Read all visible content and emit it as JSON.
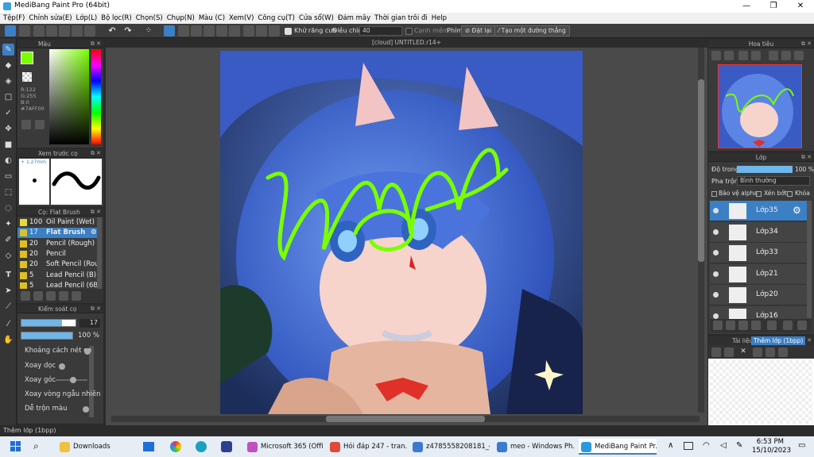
{
  "window": {
    "title": "MediBang Paint Pro (64bit)"
  },
  "menu": [
    "Tệp(F)",
    "Chỉnh sửa(E)",
    "Lớp(L)",
    "Bộ lọc(R)",
    "Chọn(S)",
    "Chụp(N)",
    "Màu (C)",
    "Xem(V)",
    "Công cụ(T)",
    "Cửa sổ(W)",
    "Đám mây",
    "Thời gian trôi đi",
    "Help"
  ],
  "toolbar": {
    "antialias_label": "Khử răng cưa",
    "correction_label": "Điều chỉnh",
    "correction_value": "40",
    "edge_label": "Cạnh mềm",
    "key_label": "Phím",
    "reset_label": "Đặt lại",
    "create_path_label": "Tạo một đường thẳng"
  },
  "document": {
    "tab": "[cloud] UNTITLED.r14+"
  },
  "color_panel": {
    "title": "Màu",
    "r": "R:122",
    "g": "G:255",
    "b": "B:0",
    "hex": "#7AFF00",
    "fg_color": "#7AFF00",
    "bg_color": "#FFFFFF"
  },
  "preview_panel": {
    "title": "Xem trước cọ",
    "size": "1.27mm"
  },
  "brush_panel": {
    "title": "Cọ: Flat Brush",
    "brushes": [
      {
        "size": "100",
        "name": "Oil Paint (Wet)",
        "color": "#e8d840"
      },
      {
        "size": "17",
        "name": "Flat Brush",
        "color": "#d9c22b"
      },
      {
        "size": "20",
        "name": "Pencil (Rough)",
        "color": "#e0c020"
      },
      {
        "size": "20",
        "name": "Pencil",
        "color": "#e0c020"
      },
      {
        "size": "20",
        "name": "Soft Pencil (Rou",
        "color": "#e0c020"
      },
      {
        "size": "5",
        "name": "Lead Pencil (B)",
        "color": "#e0c020"
      },
      {
        "size": "5",
        "name": "Lead Pencil (6B)",
        "color": "#e0c020"
      }
    ]
  },
  "brush_control": {
    "title": "Kiểm soát cọ",
    "size_value": "17",
    "size_fill": 0.75,
    "opacity_value": "100 %",
    "opacity_fill": 1.0,
    "settings": [
      "Khoảng cách nét cọ",
      "Xoay dọc",
      "Xoay góc",
      "Xoay vòng ngẫu nhiên",
      "Dễ trộn màu"
    ]
  },
  "navigator": {
    "title": "Hoa tiêu"
  },
  "layer_panel": {
    "title": "Lớp",
    "opacity_label": "Độ trong",
    "opacity_value": "100 %",
    "blend_label": "Pha trộn",
    "blend_value": "Bình thường",
    "protect_alpha": "Bảo vệ alpha",
    "clipping": "Xén bớt",
    "lock": "Khóa",
    "layers": [
      "Lớp35",
      "Lớp34",
      "Lớp33",
      "Lớp21",
      "Lớp20",
      "Lớp16"
    ]
  },
  "material_panel": {
    "tab1": "Tài liệu",
    "tab2": "Thêm lớp (1bpp)"
  },
  "status": "Thêm lớp (1bpp)",
  "taskbar": {
    "items": [
      {
        "label": "Downloads",
        "color": "#f0c040"
      },
      {
        "label": "Microsoft 365 (Offi...",
        "color": "#c04fc0"
      },
      {
        "label": "Hỏi đáp 247 - tran...",
        "color": "#e04a3a"
      },
      {
        "label": "z4785558208181_e...",
        "color": "#3a7ad0"
      },
      {
        "label": "meo - Windows Ph...",
        "color": "#3a7ad0"
      },
      {
        "label": "MediBang Paint Pr...",
        "color": "#2a9ae0"
      }
    ],
    "time": "6:53 PM",
    "date": "15/10/2023"
  }
}
